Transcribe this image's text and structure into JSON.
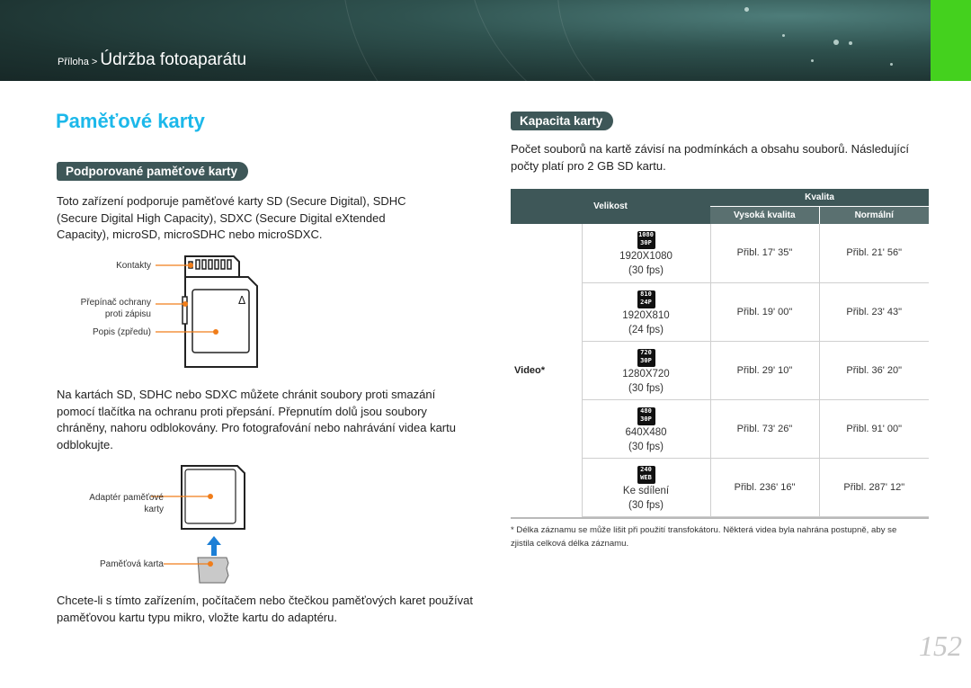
{
  "header": {
    "breadcrumb_prefix": "Příloha > ",
    "breadcrumb_title": "Údržba fotoaparátu",
    "accent_green": "#44d11e",
    "banner_color": "#2f524f"
  },
  "page_title": "Paměťové karty",
  "left": {
    "section_heading": "Podporované paměťové karty",
    "intro": "Toto zařízení podporuje paměťové karty SD (Secure Digital), SDHC (Secure Digital High Capacity), SDXC (Secure Digital eXtended Capacity), microSD, microSDHC nebo microSDXC.",
    "card_labels": {
      "contacts": "Kontakty",
      "write_protect_1": "Přepínač ochrany",
      "write_protect_2": "proti zápisu",
      "label": "Popis (zpředu)"
    },
    "protect_text": "Na kartách SD, SDHC nebo SDXC můžete chránit soubory proti smazání pomocí tlačítka na ochranu proti přepsání. Přepnutím dolů jsou soubory chráněny, nahoru odblokovány. Pro fotografování nebo nahrávání videa kartu odblokujte.",
    "adapter_labels": {
      "adapter_1": "Adaptér paměťové",
      "adapter_2": "karty",
      "memory_card": "Paměťová karta"
    },
    "micro_text": "Chcete-li s tímto zařízením, počítačem nebo čtečkou paměťových karet používat paměťovou kartu typu mikro, vložte kartu do adaptéru."
  },
  "right": {
    "section_heading": "Kapacita karty",
    "intro": "Počet souborů na kartě závisí na podmínkách a obsahu souborů. Následující počty platí pro 2 GB SD kartu.",
    "table": {
      "col_size": "Velikost",
      "col_quality": "Kvalita",
      "col_high": "Vysoká kvalita",
      "col_normal": "Normální",
      "category": "Video*",
      "rows": [
        {
          "icon_top": "1080",
          "icon_bottom": "30P",
          "resolution": "1920X1080",
          "fps": "(30 fps)",
          "high": "Přibl. 17' 35\"",
          "normal": "Přibl. 21' 56\""
        },
        {
          "icon_top": "810",
          "icon_bottom": "24P",
          "resolution": "1920X810",
          "fps": "(24 fps)",
          "high": "Přibl. 19' 00\"",
          "normal": "Přibl. 23' 43\""
        },
        {
          "icon_top": "720",
          "icon_bottom": "30P",
          "resolution": "1280X720",
          "fps": "(30 fps)",
          "high": "Přibl. 29' 10\"",
          "normal": "Přibl. 36' 20\""
        },
        {
          "icon_top": "480",
          "icon_bottom": "30P",
          "resolution": "640X480",
          "fps": "(30 fps)",
          "high": "Přibl. 73' 26\"",
          "normal": "Přibl. 91' 00\""
        },
        {
          "icon_top": "240",
          "icon_bottom": "WEB",
          "resolution": "Ke sdílení",
          "fps": "(30 fps)",
          "high": "Přibl. 236' 16\"",
          "normal": "Přibl. 287' 12\""
        }
      ]
    },
    "footnote": "* Délka záznamu se může lišit při použití transfokátoru. Některá videa byla nahrána postupně, aby se zjistila celková délka záznamu."
  },
  "page_number": "152",
  "colors": {
    "title_blue": "#1cb8ea",
    "pill_bg": "#3e5758",
    "callout_orange": "#f07d1a"
  }
}
